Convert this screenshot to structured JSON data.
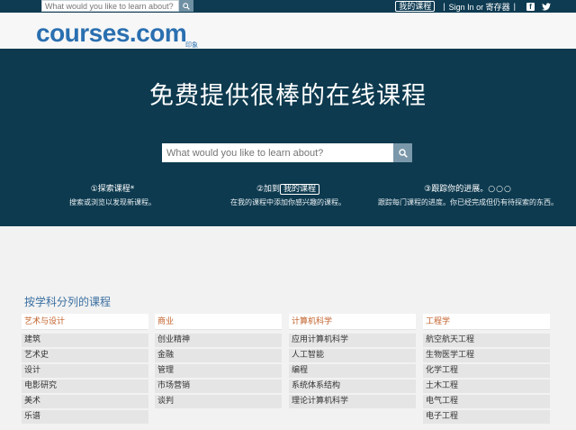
{
  "topbar": {
    "search_placeholder": "What would you like to learn about?",
    "my_courses": "我的课程",
    "separator1": "|",
    "signin": "Sign In or 寄存器",
    "separator2": "|",
    "facebook": "f",
    "twitter": "t"
  },
  "logo": {
    "text": "courses.com",
    "sub": "印象"
  },
  "hero": {
    "title": "免费提供很棒的在线课程",
    "search_placeholder": "What would you like to learn about?",
    "steps": [
      {
        "num": "①",
        "title": "探索课程",
        "suffix": "*",
        "desc": "搜索或浏览以发现新课程。"
      },
      {
        "num": "②",
        "title": "加到",
        "pill": "我的课程",
        "desc": "在我的课程中添加你感兴趣的课程。"
      },
      {
        "num": "③",
        "title": "跟踪你的进展。",
        "dots": "○○○",
        "desc": "跟踪每门课程的进度。你已经完成但仍有待探索的东西。"
      }
    ]
  },
  "subjects": {
    "title": "按学科分列的课程",
    "columns": [
      {
        "heading": "艺术与设计",
        "items": [
          "建筑",
          "艺术史",
          "设计",
          "电影研究",
          "美术",
          "乐谱"
        ]
      },
      {
        "heading": "商业",
        "items": [
          "创业精神",
          "金融",
          "管理",
          "市场营销",
          "谈判"
        ]
      },
      {
        "heading": "计算机科学",
        "items": [
          "应用计算机科学",
          "人工智能",
          "编程",
          "系统体系结构",
          "理论计算机科学"
        ]
      },
      {
        "heading": "工程学",
        "items": [
          "航空航天工程",
          "生物医学工程",
          "化学工程",
          "土木工程",
          "电气工程",
          "电子工程"
        ]
      }
    ]
  },
  "colors": {
    "navy": "#0d3a4f",
    "logo_blue": "#2a6fb0",
    "heading_orange": "#c1602a"
  }
}
